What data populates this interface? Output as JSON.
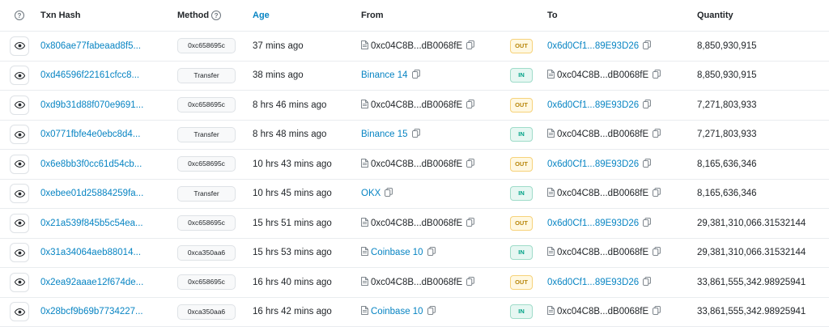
{
  "headers": {
    "txn_hash": "Txn Hash",
    "method": "Method",
    "age": "Age",
    "from": "From",
    "to": "To",
    "quantity": "Quantity"
  },
  "icons": {
    "eye": "eye-icon",
    "help": "question-circle-icon",
    "contract": "document-icon",
    "copy": "copy-icon"
  },
  "colors": {
    "link": "#0784c3",
    "out_bg": "#fff8e1",
    "out_text": "#b8860b",
    "in_bg": "#e6f7f2",
    "in_text": "#00a186"
  },
  "rows": [
    {
      "hash": "0x806ae77fabeaad8f5...",
      "method": "0xc658695c",
      "age": "37 mins ago",
      "from": "0xc04C8B...dB0068fE",
      "from_contract": true,
      "from_link": false,
      "direction": "OUT",
      "to": "0x6d0Cf1...89E93D26",
      "to_contract": false,
      "to_link": true,
      "quantity": "8,850,930,915"
    },
    {
      "hash": "0xd46596f22161cfcc8...",
      "method": "Transfer",
      "age": "38 mins ago",
      "from": "Binance 14",
      "from_contract": false,
      "from_link": true,
      "direction": "IN",
      "to": "0xc04C8B...dB0068fE",
      "to_contract": true,
      "to_link": false,
      "quantity": "8,850,930,915"
    },
    {
      "hash": "0xd9b31d88f070e9691...",
      "method": "0xc658695c",
      "age": "8 hrs 46 mins ago",
      "from": "0xc04C8B...dB0068fE",
      "from_contract": true,
      "from_link": false,
      "direction": "OUT",
      "to": "0x6d0Cf1...89E93D26",
      "to_contract": false,
      "to_link": true,
      "quantity": "7,271,803,933"
    },
    {
      "hash": "0x0771fbfe4e0ebc8d4...",
      "method": "Transfer",
      "age": "8 hrs 48 mins ago",
      "from": "Binance 15",
      "from_contract": false,
      "from_link": true,
      "direction": "IN",
      "to": "0xc04C8B...dB0068fE",
      "to_contract": true,
      "to_link": false,
      "quantity": "7,271,803,933"
    },
    {
      "hash": "0x6e8bb3f0cc61d54cb...",
      "method": "0xc658695c",
      "age": "10 hrs 43 mins ago",
      "from": "0xc04C8B...dB0068fE",
      "from_contract": true,
      "from_link": false,
      "direction": "OUT",
      "to": "0x6d0Cf1...89E93D26",
      "to_contract": false,
      "to_link": true,
      "quantity": "8,165,636,346"
    },
    {
      "hash": "0xebee01d25884259fa...",
      "method": "Transfer",
      "age": "10 hrs 45 mins ago",
      "from": "OKX",
      "from_contract": false,
      "from_link": true,
      "direction": "IN",
      "to": "0xc04C8B...dB0068fE",
      "to_contract": true,
      "to_link": false,
      "quantity": "8,165,636,346"
    },
    {
      "hash": "0x21a539f845b5c54ea...",
      "method": "0xc658695c",
      "age": "15 hrs 51 mins ago",
      "from": "0xc04C8B...dB0068fE",
      "from_contract": true,
      "from_link": false,
      "direction": "OUT",
      "to": "0x6d0Cf1...89E93D26",
      "to_contract": false,
      "to_link": true,
      "quantity": "29,381,310,066.31532144"
    },
    {
      "hash": "0x31a34064aeb88014...",
      "method": "0xca350aa6",
      "age": "15 hrs 53 mins ago",
      "from": "Coinbase 10",
      "from_contract": true,
      "from_link": true,
      "direction": "IN",
      "to": "0xc04C8B...dB0068fE",
      "to_contract": true,
      "to_link": false,
      "quantity": "29,381,310,066.31532144"
    },
    {
      "hash": "0x2ea92aaae12f674de...",
      "method": "0xc658695c",
      "age": "16 hrs 40 mins ago",
      "from": "0xc04C8B...dB0068fE",
      "from_contract": true,
      "from_link": false,
      "direction": "OUT",
      "to": "0x6d0Cf1...89E93D26",
      "to_contract": false,
      "to_link": true,
      "quantity": "33,861,555,342.98925941"
    },
    {
      "hash": "0x28bcf9b69b7734227...",
      "method": "0xca350aa6",
      "age": "16 hrs 42 mins ago",
      "from": "Coinbase 10",
      "from_contract": true,
      "from_link": true,
      "direction": "IN",
      "to": "0xc04C8B...dB0068fE",
      "to_contract": true,
      "to_link": false,
      "quantity": "33,861,555,342.98925941"
    }
  ]
}
